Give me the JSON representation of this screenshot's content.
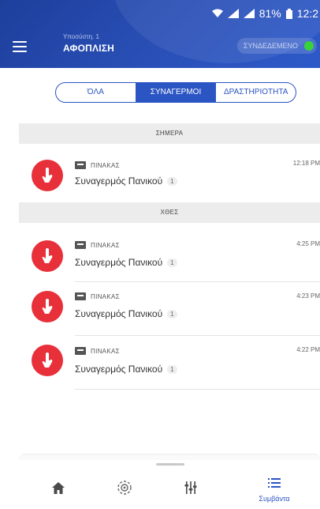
{
  "status_bar": {
    "battery": "81%",
    "time": "12:2"
  },
  "header": {
    "subtitle": "Υποσύστη. 1",
    "title": "ΑΦΟΠΛΙΣΗ",
    "connection_label": "ΣΥΝΔΕΔΕΜΕΝΟ",
    "connection_color": "#3ad23a"
  },
  "tabs": [
    {
      "label": "ΌΛΑ",
      "active": false
    },
    {
      "label": "ΣΥΝΑΓΕΡΜΟΙ",
      "active": true
    },
    {
      "label": "ΔΡΑΣΤΗΡΙΟΤΗΤΑ",
      "active": false
    }
  ],
  "groups": [
    {
      "day": "ΣΗΜΕΡΑ",
      "events": [
        {
          "icon": "panic-hand-icon",
          "source": "ΠΙΝΑΚΑΣ",
          "name": "Συναγερμός Πανικού",
          "count": "1",
          "time": "12:18 PM"
        }
      ]
    },
    {
      "day": "ΧΘΕΣ",
      "events": [
        {
          "icon": "panic-hand-icon",
          "source": "ΠΙΝΑΚΑΣ",
          "name": "Συναγερμός Πανικού",
          "count": "1",
          "time": "4:25 PM"
        },
        {
          "icon": "panic-hand-icon",
          "source": "ΠΙΝΑΚΑΣ",
          "name": "Συναγερμός Πανικού",
          "count": "1",
          "time": "4:23 PM"
        },
        {
          "icon": "panic-hand-icon",
          "source": "ΠΙΝΑΚΑΣ",
          "name": "Συναγερμός Πανικού",
          "count": "1",
          "time": "4:22 PM"
        }
      ]
    }
  ],
  "bottom_nav": [
    {
      "icon": "home-icon",
      "label": ""
    },
    {
      "icon": "detector-icon",
      "label": ""
    },
    {
      "icon": "sliders-icon",
      "label": ""
    },
    {
      "icon": "list-icon",
      "label": "Συμβάντα",
      "active": true
    }
  ],
  "colors": {
    "accent": "#2c55c4",
    "alarm": "#e8303a",
    "header": "#2a50b8"
  }
}
